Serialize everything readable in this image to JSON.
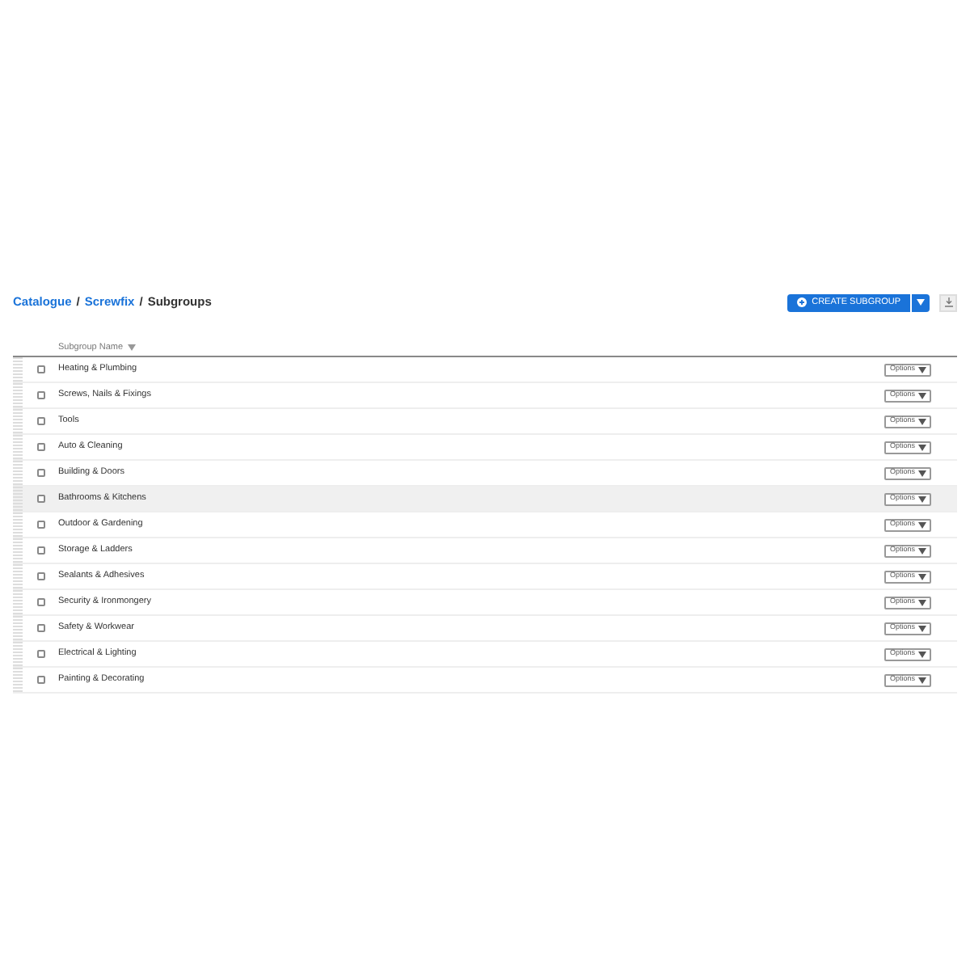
{
  "breadcrumb": {
    "separator": "/",
    "items": [
      {
        "label": "Catalogue",
        "kind": "link"
      },
      {
        "label": "Screwfix",
        "kind": "link"
      },
      {
        "label": "Subgroups",
        "kind": "current"
      }
    ]
  },
  "create_button": {
    "label": "CREATE SUBGROUP"
  },
  "table": {
    "columns": [
      {
        "label": "Subgroup Name",
        "sorted": true
      }
    ],
    "rows": [
      {
        "name": "Heating & Plumbing",
        "checked": false,
        "highlighted": false,
        "options": "Options"
      },
      {
        "name": "Screws, Nails & Fixings",
        "checked": false,
        "highlighted": false,
        "options": "Options"
      },
      {
        "name": "Tools",
        "checked": false,
        "highlighted": false,
        "options": "Options"
      },
      {
        "name": "Auto & Cleaning",
        "checked": false,
        "highlighted": false,
        "options": "Options"
      },
      {
        "name": "Building & Doors",
        "checked": false,
        "highlighted": false,
        "options": "Options"
      },
      {
        "name": "Bathrooms & Kitchens",
        "checked": false,
        "highlighted": true,
        "options": "Options"
      },
      {
        "name": "Outdoor & Gardening",
        "checked": false,
        "highlighted": false,
        "options": "Options"
      },
      {
        "name": "Storage & Ladders",
        "checked": false,
        "highlighted": false,
        "options": "Options"
      },
      {
        "name": "Sealants & Adhesives",
        "checked": false,
        "highlighted": false,
        "options": "Options"
      },
      {
        "name": "Security & Ironmongery",
        "checked": false,
        "highlighted": false,
        "options": "Options"
      },
      {
        "name": "Safety & Workwear",
        "checked": false,
        "highlighted": false,
        "options": "Options"
      },
      {
        "name": "Electrical & Lighting",
        "checked": false,
        "highlighted": false,
        "options": "Options"
      },
      {
        "name": "Painting & Decorating",
        "checked": false,
        "highlighted": false,
        "options": "Options"
      }
    ]
  }
}
